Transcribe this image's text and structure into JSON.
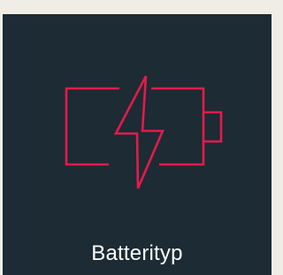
{
  "tile": {
    "label": "Batterityp",
    "icon": "battery-charging-icon"
  },
  "colors": {
    "page_background": "#efede6",
    "tile_background": "#1c2b34",
    "accent": "#e31b4b",
    "label_text": "#ffffff"
  }
}
